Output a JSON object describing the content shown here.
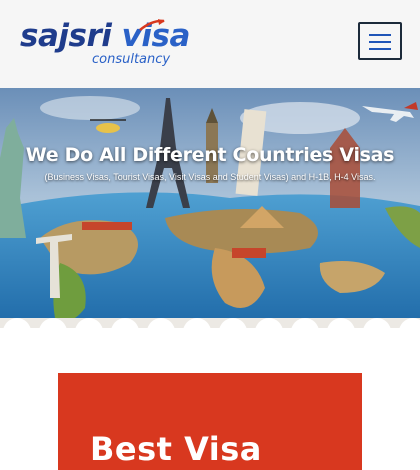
{
  "brand": {
    "name_part1": "sajsri ",
    "name_part2": "visa",
    "tagline": "consultancy"
  },
  "header": {
    "menu_icon": "hamburger-menu-icon"
  },
  "hero": {
    "title": "We Do All Different Countries Visas",
    "subtitle": "(Business Visas, Tourist Visas, Visit Visas and Student Visas) and H-1B, H-4 Visas."
  },
  "card": {
    "title": "Best Visa"
  },
  "colors": {
    "brand_dark": "#1f3c8c",
    "brand_light": "#2a61c7",
    "accent_red": "#d8381f",
    "ocean": "#2f7fbe"
  }
}
